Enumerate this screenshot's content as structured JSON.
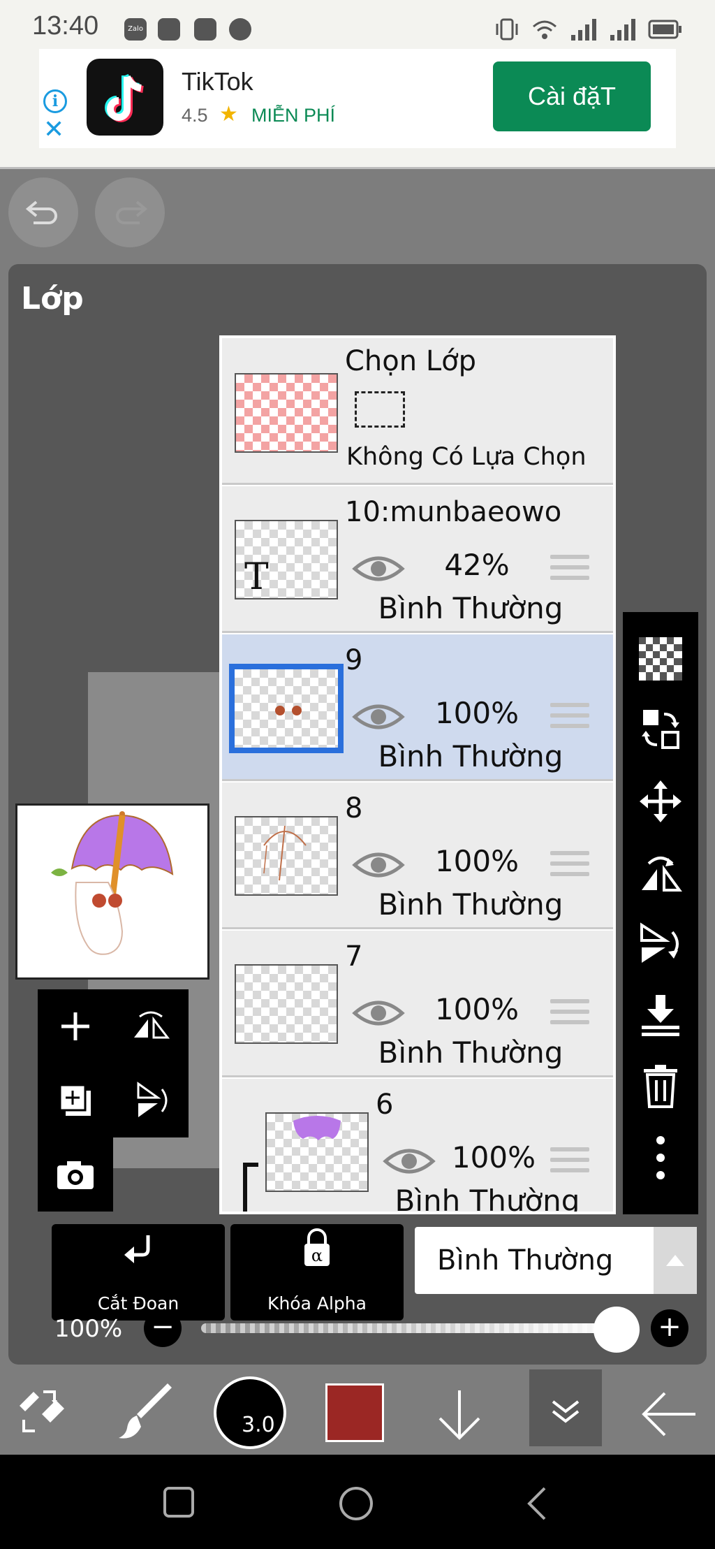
{
  "status_bar": {
    "time": "13:40",
    "app_icons": [
      "Zalo",
      "messenger-icon",
      "gallery-icon",
      "chat-icon"
    ]
  },
  "ad": {
    "title": "TikTok",
    "rating": "4.5",
    "price": "MIỄN PHÍ",
    "install_label": "Cài đặT"
  },
  "panel": {
    "title": "Lớp"
  },
  "layers": [
    {
      "name": "Chọn Lớp",
      "subtitle": "Không Có Lựa Chọn"
    },
    {
      "name": "10:munbaeowo",
      "opacity": "42%",
      "blend": "Bình Thường"
    },
    {
      "name": "9",
      "opacity": "100%",
      "blend": "Bình Thường",
      "selected": true
    },
    {
      "name": "8",
      "opacity": "100%",
      "blend": "Bình Thường"
    },
    {
      "name": "7",
      "opacity": "100%",
      "blend": "Bình Thường"
    },
    {
      "name": "6",
      "opacity": "100%",
      "blend": "Bình Thường"
    }
  ],
  "bottom_controls": {
    "clipping_label": "Cắt Đoạn",
    "alpha_lock_label": "Khóa Alpha",
    "blend_mode": "Bình Thường",
    "opacity": "100%"
  },
  "toolbar": {
    "brush_size": "3.0",
    "color": "#9b2724"
  }
}
